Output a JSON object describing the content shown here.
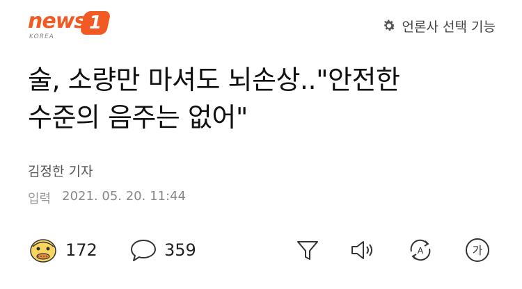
{
  "header": {
    "logo_word": "news",
    "logo_badge": "1",
    "logo_sub": "KOREA",
    "press_select_label": "언론사 선택 기능"
  },
  "article": {
    "title_line1": "술, 소량만 마셔도 뇌손상..\"안전한",
    "title_line2": "수준의 음주는 없어\"",
    "reporter": "김정한 기자",
    "date_label": "입력",
    "date_value": "2021. 05. 20. 11:44"
  },
  "toolbar": {
    "reaction_count": "172",
    "comment_count": "359",
    "font_label": "가",
    "translate_label": "A"
  },
  "colors": {
    "brand": "#f15a22",
    "text": "#111111",
    "muted": "#888888"
  },
  "icons": [
    "gear-icon",
    "emoji-reaction-icon",
    "comment-bubble-icon",
    "summary-filter-icon",
    "speaker-icon",
    "translate-icon",
    "font-size-icon"
  ]
}
